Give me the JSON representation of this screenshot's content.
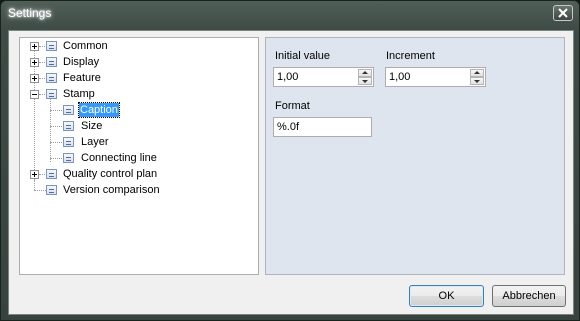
{
  "window": {
    "title": "Settings"
  },
  "tree": {
    "items": [
      {
        "label": "Common",
        "expander": "plus"
      },
      {
        "label": "Display",
        "expander": "plus"
      },
      {
        "label": "Feature",
        "expander": "plus"
      },
      {
        "label": "Stamp",
        "expander": "minus"
      },
      {
        "label": "Caption",
        "selected": true
      },
      {
        "label": "Size"
      },
      {
        "label": "Layer"
      },
      {
        "label": "Connecting line"
      },
      {
        "label": "Quality control plan",
        "expander": "plus"
      },
      {
        "label": "Version comparison"
      }
    ]
  },
  "panel": {
    "initial_value": {
      "label": "Initial value",
      "value": "1,00"
    },
    "increment": {
      "label": "Increment",
      "value": "1,00"
    },
    "format": {
      "label": "Format",
      "value": "%.0f"
    }
  },
  "buttons": {
    "ok": "OK",
    "cancel": "Abbrechen"
  },
  "icons": {
    "close": "close-icon",
    "node": "settings-node-icon",
    "expand": "expand-plus-icon",
    "collapse": "collapse-minus-icon"
  }
}
